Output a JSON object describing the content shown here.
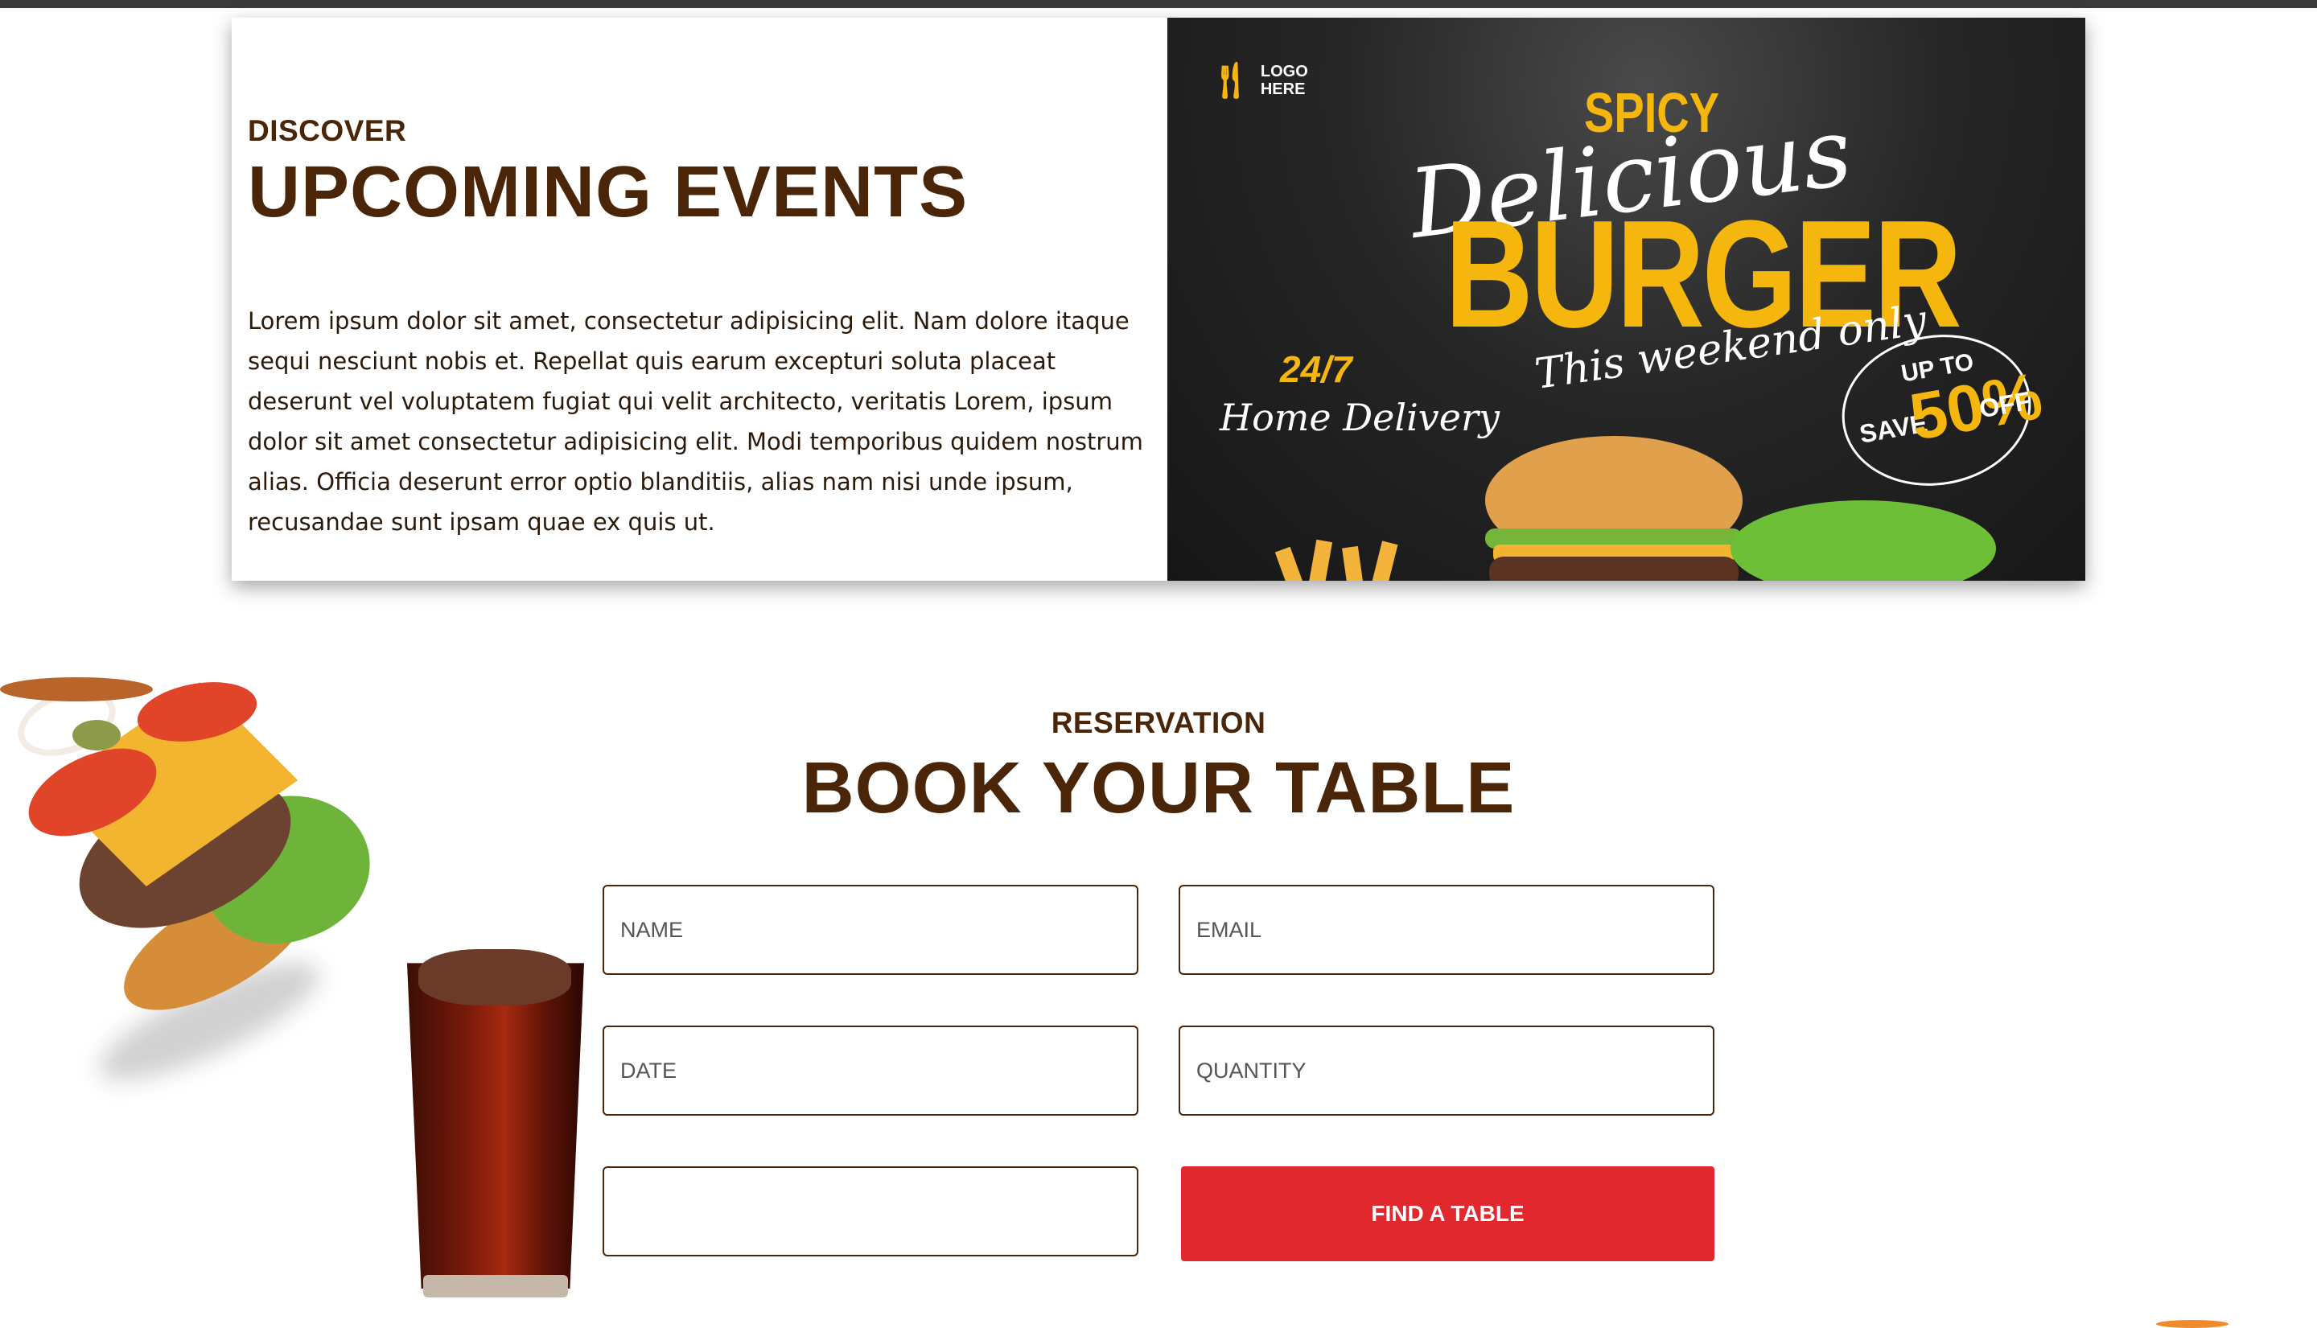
{
  "events": {
    "eyebrow": "DISCOVER",
    "title": "UPCOMING EVENTS",
    "body": "Lorem ipsum dolor sit amet, consectetur adipisicing elit. Nam dolore itaque sequi nesciunt nobis et. Repellat quis earum excepturi soluta placeat deserunt vel voluptatem fugiat qui velit architecto, veritatis Lorem, ipsum dolor sit amet consectetur adipisicing elit. Modi temporibus quidem nostrum alias. Officia deserunt error optio blanditiis, alias nam nisi unde ipsum, recusandae sunt ipsam quae ex quis ut.",
    "banner": {
      "logo_line1": "LOGO",
      "logo_line2": "HERE",
      "spicy": "SPICY",
      "delicious": "Delicious",
      "burger": "BURGER",
      "weekend": "This weekend only",
      "hours": "24/7",
      "delivery": "Home Delivery",
      "save_upto": "UP TO",
      "save_word": "SAVE",
      "save_pct": "50%",
      "save_off": "OFF"
    }
  },
  "reservation": {
    "eyebrow": "RESERVATION",
    "title": "BOOK YOUR TABLE",
    "fields": {
      "name_placeholder": "NAME",
      "email_placeholder": "EMAIL",
      "date_placeholder": "DATE",
      "quantity_placeholder": "QUANTITY",
      "extra_placeholder": ""
    },
    "submit_label": "FIND A TABLE"
  },
  "colors": {
    "heading_brown": "#4a2508",
    "button_red": "#e1282e",
    "banner_yellow": "#f5b60e"
  }
}
